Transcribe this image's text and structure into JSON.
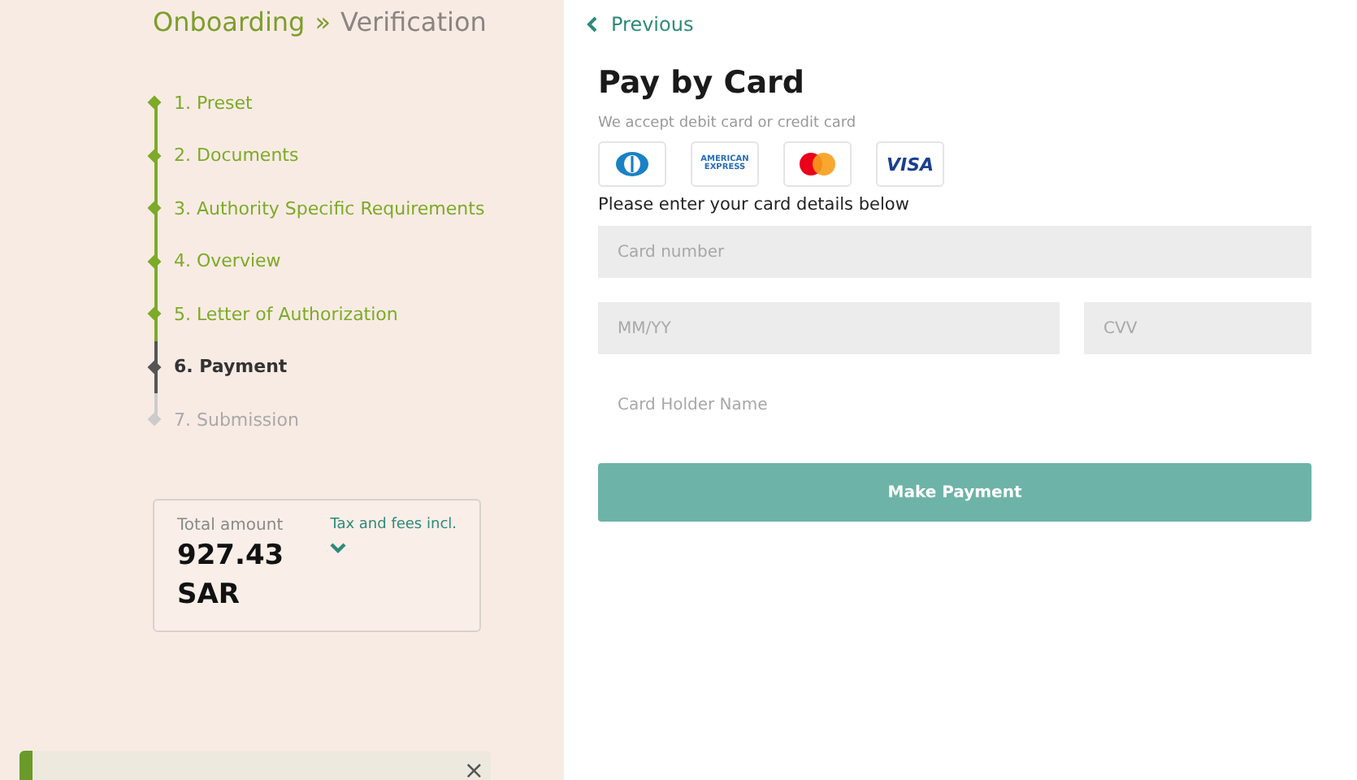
{
  "breadcrumb": {
    "parent": "Onboarding",
    "separator": "»",
    "current": "Verification"
  },
  "steps": [
    {
      "label": "1. Preset",
      "kind": "done"
    },
    {
      "label": "2. Documents",
      "kind": "done"
    },
    {
      "label": "3. Authority Specific Requirements",
      "kind": "done"
    },
    {
      "label": "4. Overview",
      "kind": "done"
    },
    {
      "label": "5. Letter of Authorization",
      "kind": "done"
    },
    {
      "label": "6. Payment",
      "kind": "current"
    },
    {
      "label": "7. Submission",
      "kind": "pending"
    }
  ],
  "total": {
    "label": "Total amount",
    "amount": "927.43",
    "currency": "SAR",
    "note": "Tax and fees incl.",
    "expanded": false
  },
  "toast": {
    "close": "×"
  },
  "back_link": "Previous",
  "title": "Pay by Card",
  "subtitle": "We accept debit card or credit card",
  "cards": [
    {
      "kind": "diners"
    },
    {
      "kind": "amex",
      "label": "AMERICAN EXPRESS"
    },
    {
      "kind": "mastercard"
    },
    {
      "kind": "visa",
      "label": "VISA"
    }
  ],
  "instructions": "Please enter your card details below",
  "fields": [
    {
      "placeholder": "Card number",
      "kind": "filled"
    },
    {
      "placeholder": "MM/YY",
      "kind": "filled"
    },
    {
      "placeholder": "CVV",
      "kind": "filled"
    },
    {
      "placeholder": "Card Holder Name",
      "kind": "plain"
    }
  ],
  "submit": "Make Payment"
}
